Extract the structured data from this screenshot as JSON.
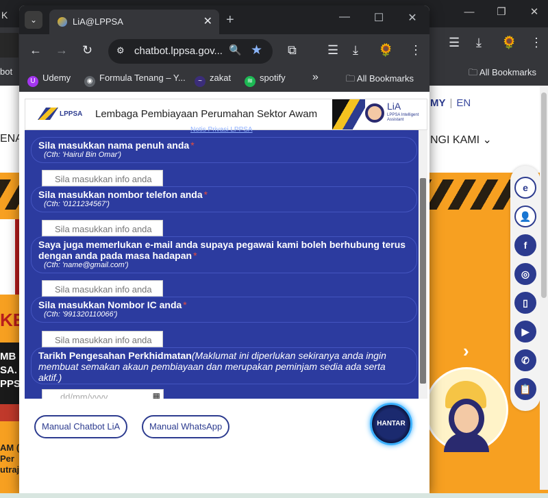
{
  "background": {
    "tab_partial": "K",
    "window_controls": [
      "—",
      "❐",
      "✕"
    ],
    "toolbar_icons": [
      "☰",
      "⤓",
      "🌻",
      "⋮"
    ],
    "bookmark_left": "bot",
    "bookmark_right": "All Bookmarks",
    "lang": {
      "my": "MY",
      "sep": "|",
      "en": "EN"
    },
    "menu_left": "ENAI",
    "menu_right": "NGI KAMI ⌄",
    "hero_kei": "KE",
    "hero_lines": [
      "MB",
      "SA.",
      "PPS"
    ],
    "bottom_lines": [
      "AM (",
      "Per",
      "utraj"
    ],
    "chevron": "›"
  },
  "popup": {
    "tab_list_icon": "⌄",
    "tab_title": "LiA@LPPSA",
    "tab_close": "✕",
    "new_tab": "+",
    "window_controls": [
      "—",
      "☐",
      "✕"
    ],
    "nav": {
      "back": "←",
      "forward": "→",
      "reload": "↻"
    },
    "url_tune": "⚙",
    "url": "chatbot.lppsa.gov...",
    "zoom_icon": "🔍",
    "star_icon": "★",
    "toolbar_icons": [
      "⧉",
      "☰",
      "⤓",
      "🌻",
      "⋮"
    ],
    "bookmarks": [
      {
        "label": "Udemy",
        "icon_text": "U",
        "color": "#a435f0"
      },
      {
        "label": "Formula Tenang – Y...",
        "icon_text": "◉",
        "color": "#5f6368"
      },
      {
        "label": "zakat",
        "icon_text": "~",
        "color": "#3b2d7a"
      },
      {
        "label": "spotify",
        "icon_text": "≋",
        "color": "#1db954"
      }
    ],
    "bookmarks_more": "»",
    "all_bookmarks": "All Bookmarks"
  },
  "chat": {
    "header_title": "Lembaga Pembiayaan Perumahan Sektor Awam",
    "logo_text": "LPPSA",
    "lia_name": "LiA",
    "lia_sub": "LPPSA Intelligent Assistant",
    "notis": "Notis Privasi LPPSA",
    "questions": [
      {
        "label": "Sila masukkan nama penuh anda",
        "example": "(Cth: 'Hairul Bin Omar')"
      },
      {
        "label": "Sila masukkan nombor telefon anda",
        "example": "(Cth: '0121234567')"
      },
      {
        "label": "Saya juga memerlukan e-mail anda supaya pegawai kami boleh berhubung terus dengan anda pada masa hadapan",
        "example": "(Cth: 'name@gmail.com')"
      },
      {
        "label": "Sila masukkan Nombor IC anda",
        "example": "(Cth: '991320110066')"
      }
    ],
    "date_question": {
      "label": "Tarikh Pengesahan Perkhidmatan",
      "note": "(Maklumat ini diperlukan sekiranya anda ingin membuat semakan akaun pembiayaan dan merupakan peminjam sedia ada serta aktif.)"
    },
    "required_mark": "*",
    "input_placeholder": "Sila masukkan info anda",
    "date_placeholder": "dd/mm/yyyy",
    "date_icon": "▦",
    "buttons": {
      "manual_chatbot": "Manual Chatbot LiA",
      "manual_whatsapp": "Manual WhatsApp",
      "send": "HANTAR"
    }
  },
  "social": [
    "e",
    "👤",
    "f",
    "◎",
    "▯",
    "▶",
    "✆",
    "📋"
  ]
}
